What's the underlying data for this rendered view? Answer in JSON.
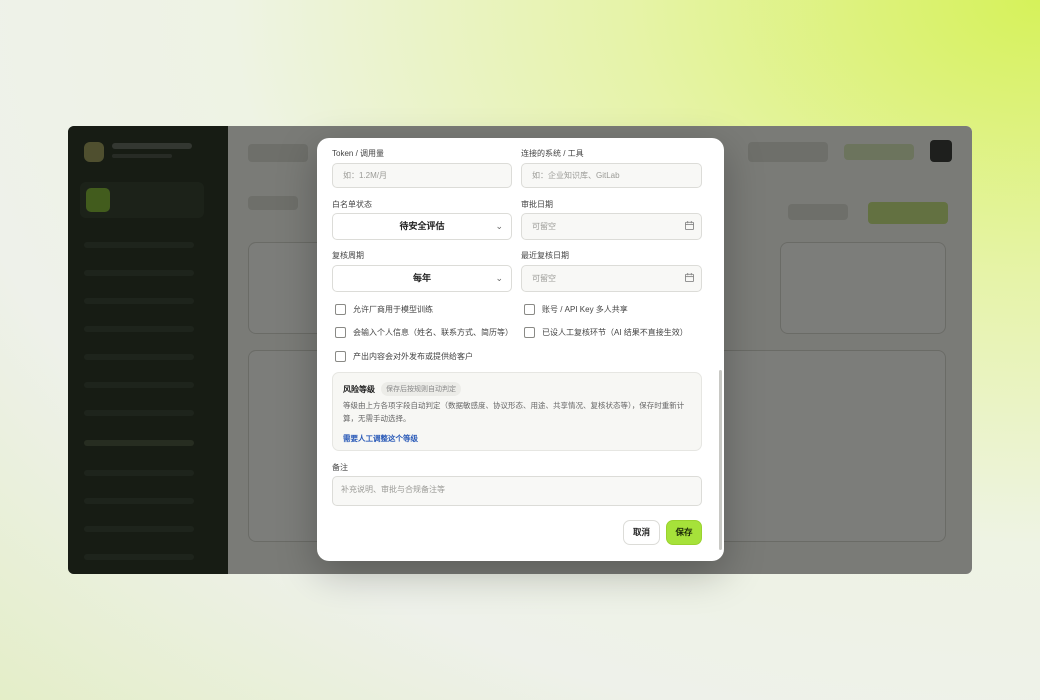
{
  "form": {
    "token_label": "Token / 调用量",
    "token_placeholder": "如：1.2M/月",
    "systems_label": "连接的系统 / 工具",
    "systems_placeholder": "如：企业知识库、GitLab",
    "whitelist_label": "白名单状态",
    "whitelist_value": "待安全评估",
    "approval_date_label": "审批日期",
    "approval_date_placeholder": "可留空",
    "review_cycle_label": "复核周期",
    "review_cycle_value": "每年",
    "last_review_label": "最近复核日期",
    "last_review_placeholder": "可留空",
    "checkboxes": [
      "允许厂商用于模型训练",
      "账号 / API Key 多人共享",
      "会输入个人信息（姓名、联系方式、简历等）",
      "已设人工复核环节（AI 结果不直接生效）",
      "产出内容会对外发布或提供给客户"
    ],
    "risk": {
      "title": "风险等级",
      "tag": "保存后按规则自动判定",
      "desc": "等级由上方各项字段自动判定（数据敏感度、协议形态、用途、共享情况、复核状态等），保存时重新计算，无需手动选择。",
      "link": "需要人工调整这个等级"
    },
    "notes_label": "备注",
    "notes_placeholder": "补充说明、审批与合规备注等",
    "cancel_label": "取消",
    "save_label": "保存"
  },
  "colors": {
    "accent": "#a6e23a",
    "link": "#2b5bb8"
  }
}
